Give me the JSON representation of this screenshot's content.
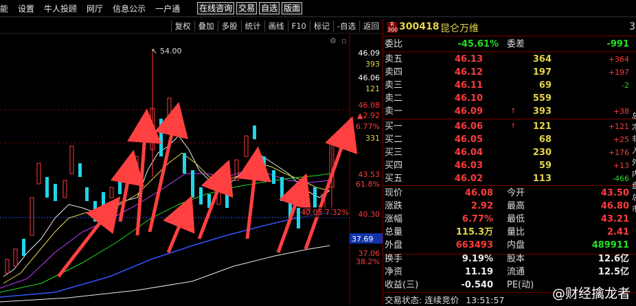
{
  "menubar": {
    "items": [
      "能",
      "设置",
      "牛人投顾",
      "网厅",
      "信息公示",
      "一户通"
    ],
    "buttons": [
      "在线咨询",
      "交易",
      "自选",
      "版面"
    ]
  },
  "toolbar": {
    "buttons": [
      "复权",
      "叠加",
      "多股",
      "统计",
      "画线",
      "F10",
      "标记",
      "-自选",
      "返回"
    ]
  },
  "chart": {
    "peak_label": "54.00",
    "price_label_a": "46.09",
    "vol_label_a": "393",
    "price_label_b": "46.06",
    "vol_label_b": "121",
    "price_label_c": "46.08",
    "change_label_c": "▲2.92",
    "pct_label_c": "6.77%",
    "vol_label_c": "331",
    "axis_1": "43.53",
    "axis_1_pct": "61.8%",
    "axis_2": "40.30",
    "crosshair_label": "40.05 7.32%",
    "current_price": "37.69",
    "axis_3": "37.06",
    "axis_3_pct": "38.2%",
    "colors": {
      "up": "#ff3b3b",
      "down": "#22d4e8",
      "ma5": "#ffffff",
      "ma10": "#e5d54a",
      "ma20": "#c040ff",
      "ma30": "#22e022",
      "ma60": "#3355ff",
      "ma120": "#eeeeee"
    }
  },
  "stock": {
    "badge_top": "R",
    "badge_bottom": "300",
    "code": "300418",
    "name": "昆仑万维",
    "side_digit": "3"
  },
  "ratio": {
    "label": "委比",
    "value": "-45.61%",
    "label2": "委差",
    "value2": "-991"
  },
  "sells": [
    {
      "label": "卖五",
      "price": "46.13",
      "vol": "364",
      "chg": "+364"
    },
    {
      "label": "卖四",
      "price": "46.12",
      "vol": "197",
      "chg": "+197"
    },
    {
      "label": "卖三",
      "price": "46.11",
      "vol": "69",
      "chg": "-2"
    },
    {
      "label": "卖二",
      "price": "46.10",
      "vol": "559",
      "chg": ""
    },
    {
      "label": "卖一",
      "price": "46.09",
      "vol": "393",
      "chg": "+38"
    }
  ],
  "buys": [
    {
      "label": "买一",
      "price": "46.06",
      "vol": "121",
      "chg": "+121"
    },
    {
      "label": "买二",
      "price": "46.05",
      "vol": "68",
      "chg": "+25"
    },
    {
      "label": "买三",
      "price": "46.04",
      "vol": "230",
      "chg": "+176"
    },
    {
      "label": "买四",
      "price": "46.03",
      "vol": "59",
      "chg": "+13"
    },
    {
      "label": "买五",
      "price": "46.02",
      "vol": "113",
      "chg": "-466"
    }
  ],
  "stats": [
    {
      "l1": "现价",
      "v1": "46.08",
      "l2": "今开",
      "v2": "43.50"
    },
    {
      "l1": "涨跌",
      "v1": "2.92",
      "l2": "最高",
      "v2": "46.80"
    },
    {
      "l1": "涨幅",
      "v1": "6.77%",
      "l2": "最低",
      "v2": "43.21"
    },
    {
      "l1": "总量",
      "v1": "115.3万",
      "l2": "量比",
      "v2": "2.41"
    },
    {
      "l1": "外盘",
      "v1": "663493",
      "l2": "内盘",
      "v2": "489911"
    }
  ],
  "stats2": [
    {
      "l1": "换手",
      "v1": "9.19%",
      "l2": "股本",
      "v2": "12.6亿"
    },
    {
      "l1": "净资",
      "v1": "11.19",
      "l2": "流通",
      "v2": "12.5亿"
    },
    {
      "l1": "收益(三)",
      "v1": "-0.540",
      "l2": "PE(动)",
      "v2": ""
    }
  ],
  "status": {
    "label": "交易状态:",
    "value": "连续竞价",
    "time": "13:51:57"
  },
  "watermark": "@财经擒龙者",
  "right_edge_chars": [
    "总",
    "净",
    "非",
    "入",
    "外",
    "内",
    "盘",
    "总",
    "市"
  ]
}
